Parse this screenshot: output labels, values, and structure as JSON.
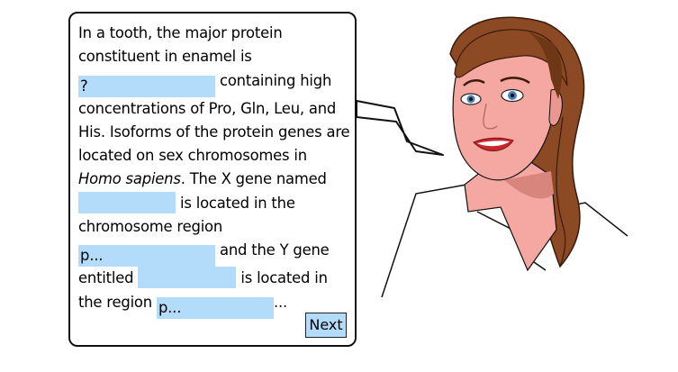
{
  "passage": {
    "line1": "In a tooth, the major protein",
    "line2": "constituent in enamel is",
    "blank1_value": "?",
    "line3_after_blank1": "containing high",
    "line4": "concentrations of Pro, Gln, Leu, and",
    "line5": "His. Isoforms of the protein genes are",
    "line6": "located on sex chromosomes in",
    "species_italic": "Homo sapiens",
    "line7_after_species": ". The X gene named",
    "blank2_value": "",
    "line8_after_blank2": "is located in the",
    "line9": "chromosome region",
    "blank3_value": "p...",
    "line10_after_blank3": "and the Y gene",
    "line11_before_blank4": "entitled",
    "blank4_value": "",
    "line11_after_blank4": "is located in",
    "line12_before_blank5": "the region",
    "blank5_value": "p...",
    "line12_after_blank5": "..."
  },
  "next_button": {
    "label": "Next"
  },
  "colors": {
    "blank_fill": "#b2dcfa",
    "bubble_border": "#111111",
    "skin": "#f5a7a2",
    "hair": "#8c4a24"
  },
  "icons": {
    "character": "teacher-woman-illustration"
  }
}
